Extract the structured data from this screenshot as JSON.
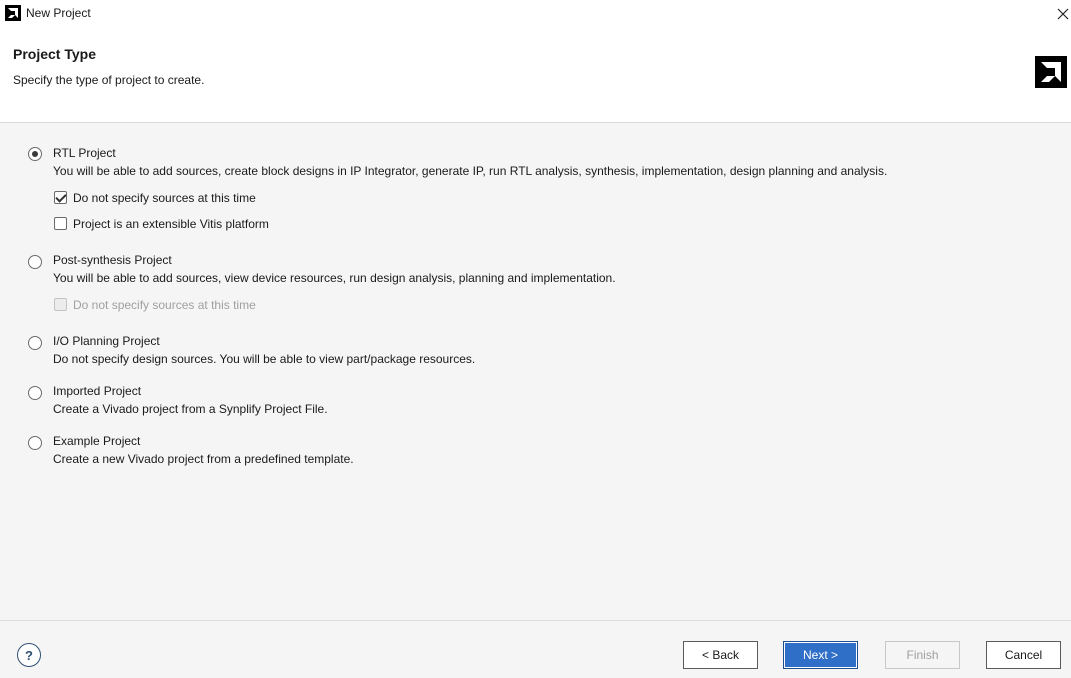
{
  "window": {
    "title": "New Project",
    "app_icon": "amd-logo-icon",
    "close_icon": "close-icon"
  },
  "header": {
    "title": "Project Type",
    "subtitle": "Specify the type of project to create.",
    "logo": "amd-logo-icon"
  },
  "options": [
    {
      "label": "RTL Project",
      "description": "You will be able to add sources, create block designs in IP Integrator, generate IP, run RTL analysis, synthesis, implementation, design planning and analysis.",
      "selected": true,
      "checkboxes": [
        {
          "label": "Do not specify sources at this time",
          "checked": true,
          "enabled": true
        },
        {
          "label": "Project is an extensible Vitis platform",
          "checked": false,
          "enabled": true
        }
      ]
    },
    {
      "label": "Post-synthesis Project",
      "description": "You will be able to add sources, view device resources, run design analysis, planning and implementation.",
      "selected": false,
      "checkboxes": [
        {
          "label": "Do not specify sources at this time",
          "checked": false,
          "enabled": false
        }
      ]
    },
    {
      "label": "I/O Planning Project",
      "description": "Do not specify design sources. You will be able to view part/package resources.",
      "selected": false
    },
    {
      "label": "Imported Project",
      "description": "Create a Vivado project from a Synplify Project File.",
      "selected": false
    },
    {
      "label": "Example Project",
      "description": "Create a new Vivado project from a predefined template.",
      "selected": false
    }
  ],
  "footer": {
    "help_label": "?",
    "back_label": "< Back",
    "next_label": "Next >",
    "finish_label": "Finish",
    "cancel_label": "Cancel"
  },
  "colors": {
    "primary_button": "#2f6fc7",
    "help_icon": "#2e4f73",
    "disabled_text": "#a0a0a0"
  }
}
